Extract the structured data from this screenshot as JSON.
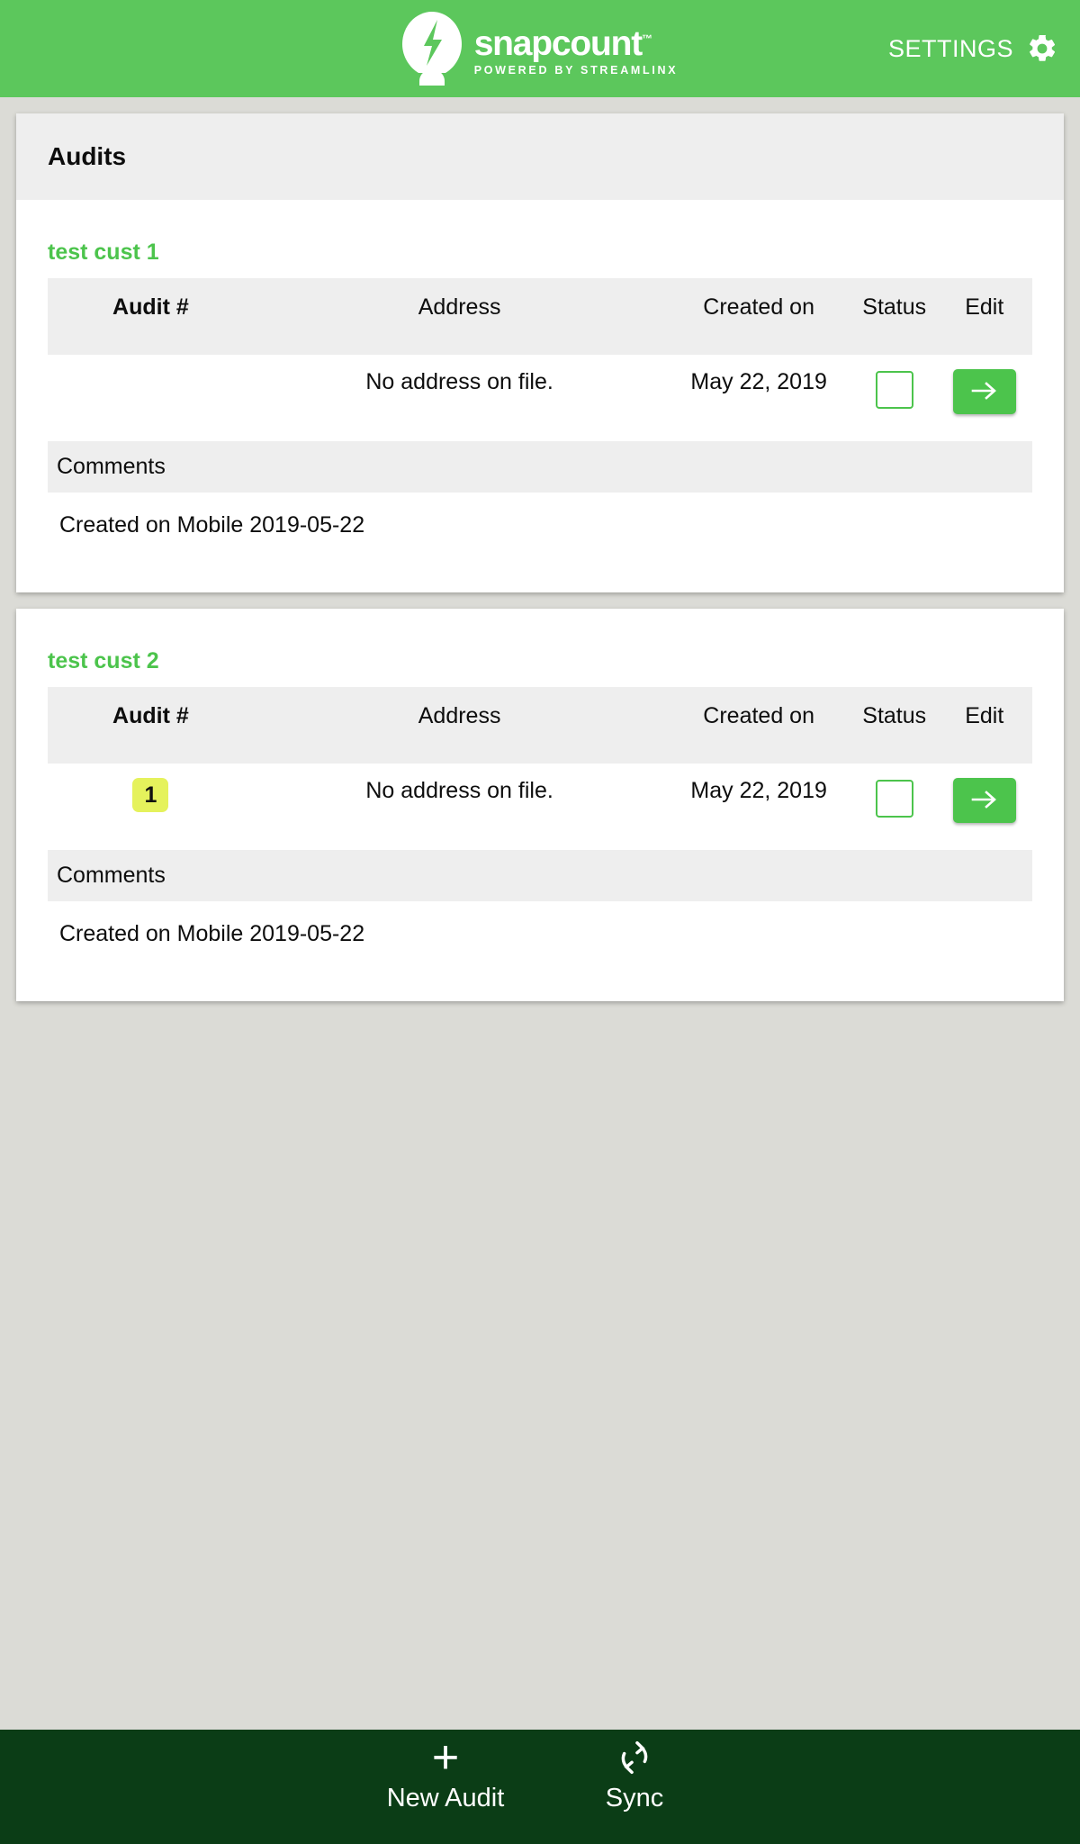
{
  "brand": {
    "logo_icon": "snapcount-bolt-logo",
    "name": "snapcount",
    "trademark": "™",
    "tagline": "POWERED BY STREAMLINX",
    "header_green": "#5cc75c",
    "accent_green": "#4cc44c",
    "footer_green": "#0b3d16",
    "badge_yellow": "#e5f25c",
    "page_background": "#dbdbd6"
  },
  "topbar": {
    "settings_label": "SETTINGS",
    "settings_icon": "gear-icon"
  },
  "page": {
    "title": "Audits"
  },
  "table": {
    "columns": [
      "Audit #",
      "Address",
      "Created on",
      "Status",
      "Edit"
    ],
    "comments_label": "Comments"
  },
  "cards": [
    {
      "customer": "test cust 1",
      "rows": [
        {
          "audit_number": "",
          "address": "No address on file.",
          "created_on": "May 22, 2019",
          "status_checked": false,
          "edit_icon": "arrow-right-icon"
        }
      ],
      "comment": "Created on Mobile 2019-05-22"
    },
    {
      "customer": "test cust 2",
      "rows": [
        {
          "audit_number": "1",
          "address": "No address on file.",
          "created_on": "May 22, 2019",
          "status_checked": false,
          "edit_icon": "arrow-right-icon"
        }
      ],
      "comment": "Created on Mobile 2019-05-22"
    }
  ],
  "footer": {
    "items": [
      {
        "icon": "plus-icon",
        "label": "New Audit"
      },
      {
        "icon": "sync-icon",
        "label": "Sync"
      }
    ]
  }
}
